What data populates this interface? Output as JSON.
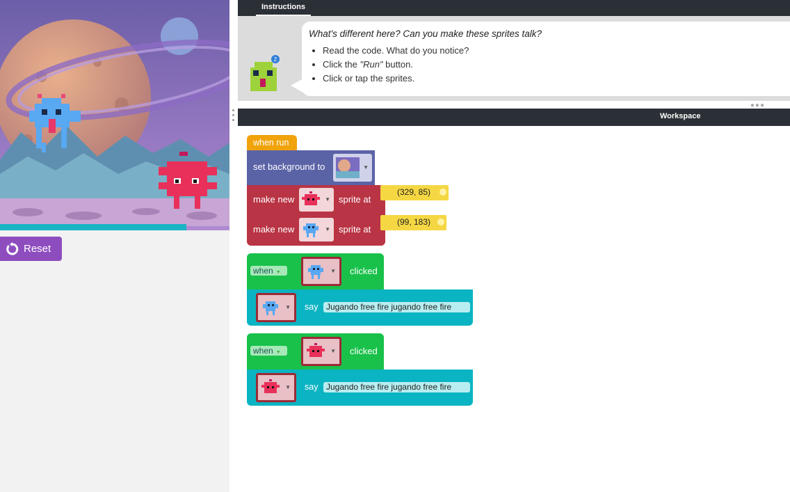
{
  "app": {
    "reset_label": "Reset",
    "reset_icon": "reset-icon"
  },
  "instructions": {
    "tab_label": "Instructions",
    "question": "What's different here? Can you make these sprites talk?",
    "items": [
      {
        "pre": "Read the code. What do you notice?",
        "em": "",
        "post": ""
      },
      {
        "pre": "Click the ",
        "em": "\"Run\"",
        "post": " button."
      },
      {
        "pre": "Click or tap the sprites.",
        "em": "",
        "post": ""
      }
    ],
    "avatar_badge": "2"
  },
  "workspace": {
    "title": "Workspace",
    "blocks": {
      "when_run": "when run",
      "set_background": "set background to",
      "make_new_1": {
        "label": "make new",
        "suffix": "sprite at",
        "coords": "(329, 85)"
      },
      "make_new_2": {
        "label": "make new",
        "suffix": "sprite at",
        "coords": "(99, 183)"
      },
      "event_1": {
        "when": "when",
        "clicked": "clicked",
        "say": "say",
        "text": "Jugando free fire jugando free fire"
      },
      "event_2": {
        "when": "when",
        "clicked": "clicked",
        "say": "say",
        "text": "Jugando free fire jugando free fire"
      }
    }
  },
  "colors": {
    "event_hat": "#f0a30a",
    "looks": "#5b63a7",
    "sprite": "#b93444",
    "events": "#19c14a",
    "say": "#0bb4c2",
    "reset": "#8e4dbf"
  }
}
